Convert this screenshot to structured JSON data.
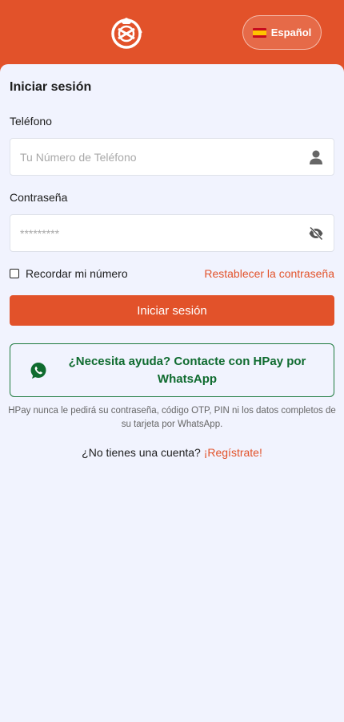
{
  "header": {
    "language_label": "Español",
    "flag_icon": "spain-flag-icon",
    "brand_color": "#e2522a"
  },
  "login": {
    "title": "Iniciar sesión",
    "phone_label": "Teléfono",
    "phone_placeholder": "Tu Número de Teléfono",
    "password_label": "Contraseña",
    "password_placeholder": "*********",
    "remember_label": "Recordar mi número",
    "reset_link": "Restablecer la contraseña",
    "submit_label": "Iniciar sesión"
  },
  "help": {
    "whatsapp_text": "¿Necesita ayuda? Contacte con HPay por WhatsApp",
    "notice": "HPay nunca le pedirá su contraseña, código OTP, PIN ni los datos completos de su tarjeta por WhatsApp."
  },
  "signup": {
    "prompt": "¿No tienes una cuenta?",
    "link": "¡Regístrate!"
  }
}
